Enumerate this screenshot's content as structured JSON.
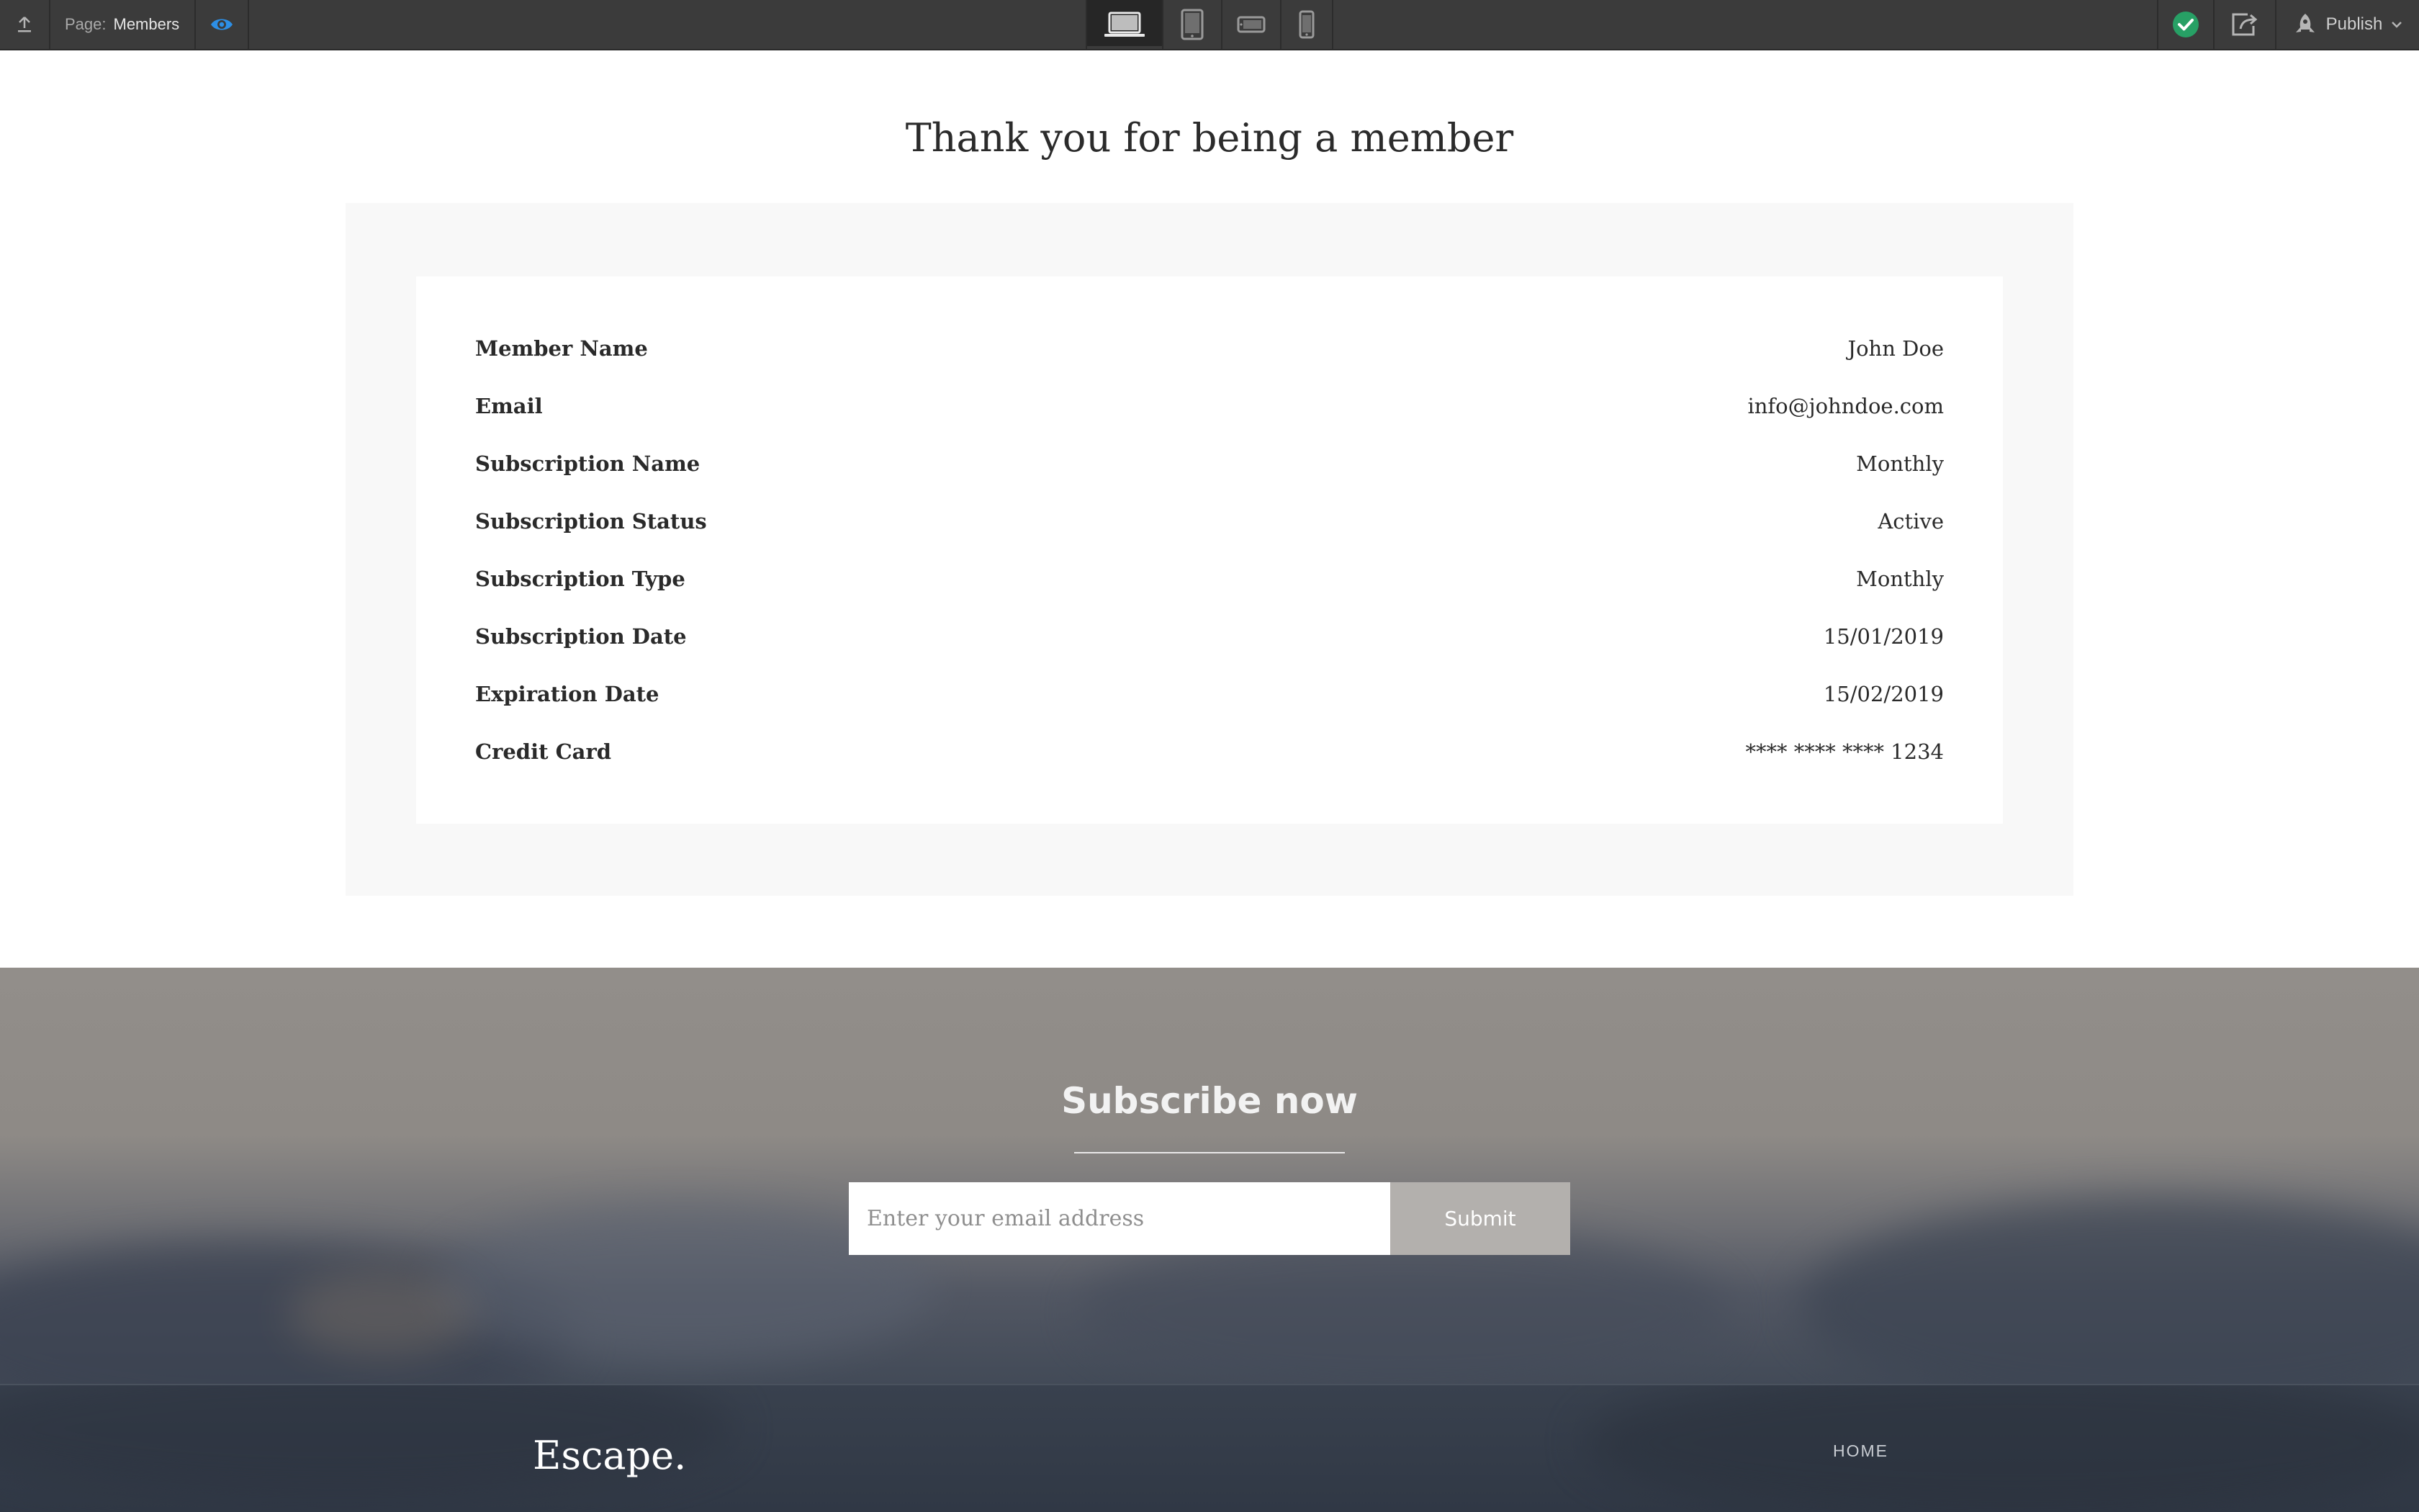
{
  "toolbar": {
    "page_label": "Page:",
    "page_name": "Members",
    "publish_label": "Publish",
    "icons": {
      "export": "upload-icon",
      "preview": "eye-icon",
      "desktop": "laptop-icon",
      "tablet": "tablet-icon",
      "landscape": "phone-landscape-icon",
      "mobile": "phone-icon",
      "status": "check-circle-icon",
      "share": "share-icon",
      "publish": "rocket-icon"
    },
    "active_device": "desktop"
  },
  "main": {
    "title": "Thank you for being a member",
    "details": [
      {
        "label": "Member Name",
        "value": "John Doe"
      },
      {
        "label": "Email",
        "value": "info@johndoe.com"
      },
      {
        "label": "Subscription Name",
        "value": "Monthly"
      },
      {
        "label": "Subscription Status",
        "value": "Active"
      },
      {
        "label": "Subscription Type",
        "value": "Monthly"
      },
      {
        "label": "Subscription Date",
        "value": "15/01/2019"
      },
      {
        "label": "Expiration Date",
        "value": "15/02/2019"
      },
      {
        "label": "Credit Card",
        "value": "**** **** **** 1234"
      }
    ]
  },
  "subscribe": {
    "title": "Subscribe now",
    "email_placeholder": "Enter your email address",
    "email_value": "",
    "submit_label": "Submit"
  },
  "footer": {
    "brand": "Escape.",
    "nav": [
      "HOME"
    ]
  },
  "colors": {
    "toolbar_bg": "#3b3b3b",
    "preview_accent": "#2d8fe6",
    "status_ok": "#27a065",
    "card_outer": "#f8f8f8",
    "submit_bg": "#b3b0ad"
  }
}
